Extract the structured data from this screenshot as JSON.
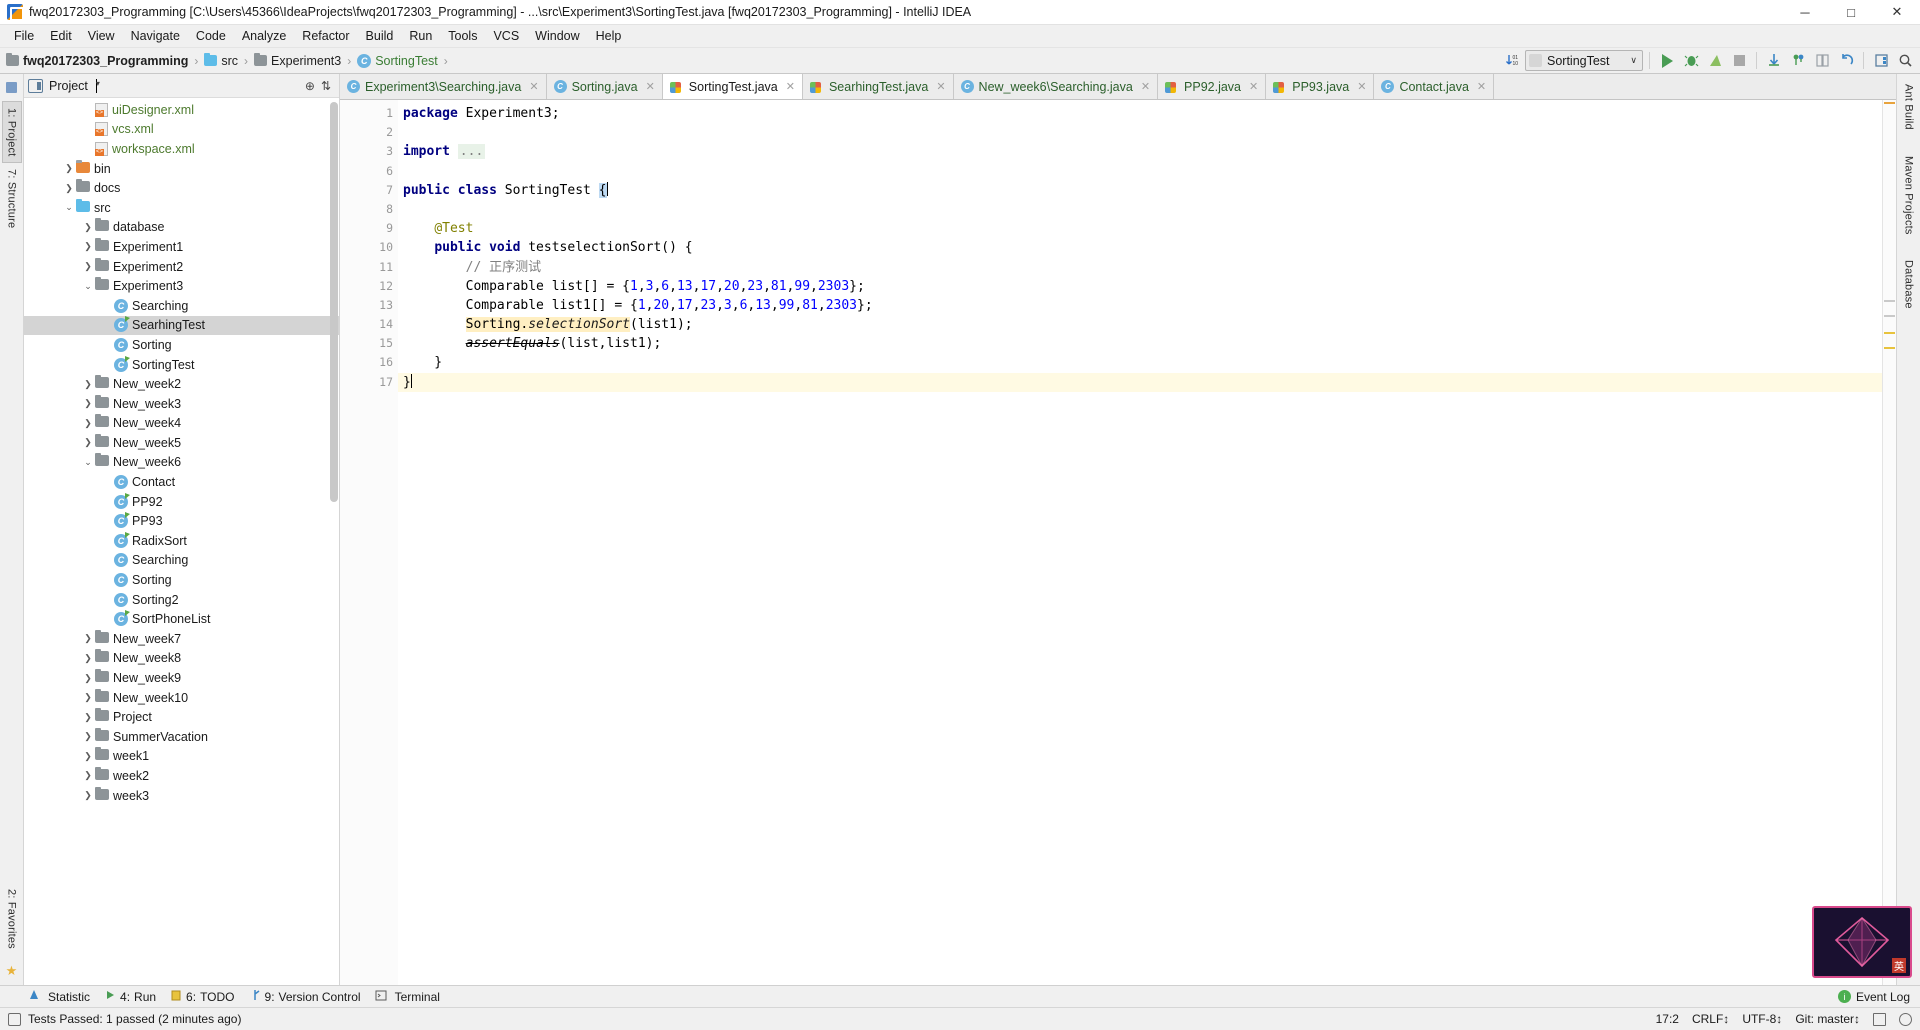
{
  "window": {
    "title": "fwq20172303_Programming [C:\\Users\\45366\\IdeaProjects\\fwq20172303_Programming] - ...\\src\\Experiment3\\SortingTest.java [fwq20172303_Programming] - IntelliJ IDEA",
    "minimize": "─",
    "maximize": "□",
    "close": "✕"
  },
  "menu": [
    {
      "label": "File"
    },
    {
      "label": "Edit"
    },
    {
      "label": "View"
    },
    {
      "label": "Navigate"
    },
    {
      "label": "Code"
    },
    {
      "label": "Analyze"
    },
    {
      "label": "Refactor"
    },
    {
      "label": "Build"
    },
    {
      "label": "Run"
    },
    {
      "label": "Tools"
    },
    {
      "label": "VCS"
    },
    {
      "label": "Window"
    },
    {
      "label": "Help"
    }
  ],
  "breadcrumb": [
    {
      "label": "fwq20172303_Programming",
      "icon": "folder-icon"
    },
    {
      "label": "src",
      "icon": "folder-icon"
    },
    {
      "label": "Experiment3",
      "icon": "folder-icon"
    },
    {
      "label": "SortingTest",
      "icon": "java-class-icon"
    }
  ],
  "toolbar": {
    "sort_icon": "sort-descending-icon",
    "run_config": "SortingTest",
    "run_config_caret": "∨",
    "run_label": "run-button",
    "debug_label": "debug-button",
    "coverage_label": "run-with-coverage-button",
    "stop_label": "stop-button",
    "update_label": "update-project-button",
    "commit_label": "commit-button",
    "compare_label": "compare-button",
    "rollback_label": "rollback-button",
    "layout_label": "layout-button",
    "search_label": "search-everywhere-button"
  },
  "project_panel": {
    "title": "Project",
    "caret": "▾",
    "target_icon": "locate-icon",
    "collapse_icon": "collapse-all-icon",
    "tree": [
      {
        "label": "uiDesigner.xml",
        "indent": 3,
        "arrow": "",
        "icon": "xml-file-icon",
        "selected": false
      },
      {
        "label": "vcs.xml",
        "indent": 3,
        "arrow": "",
        "icon": "xml-file-icon",
        "selected": false
      },
      {
        "label": "workspace.xml",
        "indent": 3,
        "arrow": "",
        "icon": "xml-file-icon",
        "selected": false
      },
      {
        "label": "bin",
        "indent": 2,
        "arrow": "❯",
        "icon": "folder-orange-icon",
        "selected": false
      },
      {
        "label": "docs",
        "indent": 2,
        "arrow": "❯",
        "icon": "folder-icon",
        "selected": false
      },
      {
        "label": "src",
        "indent": 2,
        "arrow": "⌄",
        "icon": "folder-blue-icon",
        "selected": false
      },
      {
        "label": "database",
        "indent": 3,
        "arrow": "❯",
        "icon": "folder-pkg-icon",
        "selected": false
      },
      {
        "label": "Experiment1",
        "indent": 3,
        "arrow": "❯",
        "icon": "folder-pkg-icon",
        "selected": false
      },
      {
        "label": "Experiment2",
        "indent": 3,
        "arrow": "❯",
        "icon": "folder-pkg-icon",
        "selected": false
      },
      {
        "label": "Experiment3",
        "indent": 3,
        "arrow": "⌄",
        "icon": "folder-pkg-icon",
        "selected": false
      },
      {
        "label": "Searching",
        "indent": 4,
        "arrow": "",
        "icon": "java-class-icon",
        "selected": false
      },
      {
        "label": "SearhingTest",
        "indent": 4,
        "arrow": "",
        "icon": "java-test-class-icon",
        "selected": true
      },
      {
        "label": "Sorting",
        "indent": 4,
        "arrow": "",
        "icon": "java-class-icon",
        "selected": false
      },
      {
        "label": "SortingTest",
        "indent": 4,
        "arrow": "",
        "icon": "java-test-class-icon",
        "selected": false
      },
      {
        "label": "New_week2",
        "indent": 3,
        "arrow": "❯",
        "icon": "folder-pkg-icon",
        "selected": false
      },
      {
        "label": "New_week3",
        "indent": 3,
        "arrow": "❯",
        "icon": "folder-pkg-icon",
        "selected": false
      },
      {
        "label": "New_week4",
        "indent": 3,
        "arrow": "❯",
        "icon": "folder-pkg-icon",
        "selected": false
      },
      {
        "label": "New_week5",
        "indent": 3,
        "arrow": "❯",
        "icon": "folder-pkg-icon",
        "selected": false
      },
      {
        "label": "New_week6",
        "indent": 3,
        "arrow": "⌄",
        "icon": "folder-pkg-icon",
        "selected": false
      },
      {
        "label": "Contact",
        "indent": 4,
        "arrow": "",
        "icon": "java-class-icon",
        "selected": false
      },
      {
        "label": "PP92",
        "indent": 4,
        "arrow": "",
        "icon": "java-test-class-icon",
        "selected": false
      },
      {
        "label": "PP93",
        "indent": 4,
        "arrow": "",
        "icon": "java-test-class-icon",
        "selected": false
      },
      {
        "label": "RadixSort",
        "indent": 4,
        "arrow": "",
        "icon": "java-test-class-icon",
        "selected": false
      },
      {
        "label": "Searching",
        "indent": 4,
        "arrow": "",
        "icon": "java-class-icon",
        "selected": false
      },
      {
        "label": "Sorting",
        "indent": 4,
        "arrow": "",
        "icon": "java-class-icon",
        "selected": false
      },
      {
        "label": "Sorting2",
        "indent": 4,
        "arrow": "",
        "icon": "java-class-icon",
        "selected": false
      },
      {
        "label": "SortPhoneList",
        "indent": 4,
        "arrow": "",
        "icon": "java-test-class-icon",
        "selected": false
      },
      {
        "label": "New_week7",
        "indent": 3,
        "arrow": "❯",
        "icon": "folder-pkg-icon",
        "selected": false
      },
      {
        "label": "New_week8",
        "indent": 3,
        "arrow": "❯",
        "icon": "folder-pkg-icon",
        "selected": false
      },
      {
        "label": "New_week9",
        "indent": 3,
        "arrow": "❯",
        "icon": "folder-pkg-icon",
        "selected": false
      },
      {
        "label": "New_week10",
        "indent": 3,
        "arrow": "❯",
        "icon": "folder-pkg-icon",
        "selected": false
      },
      {
        "label": "Project",
        "indent": 3,
        "arrow": "❯",
        "icon": "folder-pkg-icon",
        "selected": false
      },
      {
        "label": "SummerVacation",
        "indent": 3,
        "arrow": "❯",
        "icon": "folder-pkg-icon",
        "selected": false
      },
      {
        "label": "week1",
        "indent": 3,
        "arrow": "❯",
        "icon": "folder-pkg-icon",
        "selected": false
      },
      {
        "label": "week2",
        "indent": 3,
        "arrow": "❯",
        "icon": "folder-pkg-icon",
        "selected": false
      },
      {
        "label": "week3",
        "indent": 3,
        "arrow": "❯",
        "icon": "folder-pkg-icon",
        "selected": false
      }
    ]
  },
  "left_rail": [
    {
      "label": "1: Project",
      "active": true
    },
    {
      "label": "7: Structure",
      "active": false
    },
    {
      "label": "2: Favorites",
      "active": false
    }
  ],
  "right_rail": [
    {
      "label": "Ant Build"
    },
    {
      "label": "Maven Projects"
    },
    {
      "label": "Database"
    }
  ],
  "editor_tabs": [
    {
      "label": "Experiment3\\Searching.java",
      "icon": "java-class-icon",
      "active": false,
      "close": "✕"
    },
    {
      "label": "Sorting.java",
      "icon": "java-class-icon",
      "active": false,
      "close": "✕"
    },
    {
      "label": "SortingTest.java",
      "icon": "java-test-icon",
      "active": true,
      "close": "✕"
    },
    {
      "label": "SearhingTest.java",
      "icon": "java-test-icon",
      "active": false,
      "close": "✕"
    },
    {
      "label": "New_week6\\Searching.java",
      "icon": "java-class-icon",
      "active": false,
      "close": "✕"
    },
    {
      "label": "PP92.java",
      "icon": "java-test-icon",
      "active": false,
      "close": "✕"
    },
    {
      "label": "PP93.java",
      "icon": "java-test-icon",
      "active": false,
      "close": "✕"
    },
    {
      "label": "Contact.java",
      "icon": "java-class-icon",
      "active": false,
      "close": "✕"
    }
  ],
  "code": {
    "line_numbers": [
      "1",
      "2",
      "3",
      "6",
      "7",
      "8",
      "9",
      "10",
      "11",
      "12",
      "13",
      "14",
      "15",
      "16",
      "17"
    ],
    "lines": [
      {
        "no": "1",
        "text": "package Experiment3;"
      },
      {
        "no": "2",
        "text": ""
      },
      {
        "no": "3",
        "text": "import ..."
      },
      {
        "no": "6",
        "text": ""
      },
      {
        "no": "7",
        "text": "public class SortingTest {"
      },
      {
        "no": "8",
        "text": ""
      },
      {
        "no": "9",
        "text": "    @Test"
      },
      {
        "no": "10",
        "text": "    public void testselectionSort() {"
      },
      {
        "no": "11",
        "text": "        // 正序测试"
      },
      {
        "no": "12",
        "text": "        Comparable list[] = {1,3,6,13,17,20,23,81,99,2303};"
      },
      {
        "no": "13",
        "text": "        Comparable list1[] = {1,20,17,23,3,6,13,99,81,2303};"
      },
      {
        "no": "14",
        "text": "        Sorting.selectionSort(list1);"
      },
      {
        "no": "15",
        "text": "        assertEquals(list,list1);"
      },
      {
        "no": "16",
        "text": "    }"
      },
      {
        "no": "17",
        "text": "}"
      }
    ]
  },
  "bottom_tools": [
    {
      "num": "",
      "label": "Statistic",
      "icon": "statistic-icon"
    },
    {
      "num": "4:",
      "label": "Run",
      "icon": "run-icon"
    },
    {
      "num": "6:",
      "label": "TODO",
      "icon": "todo-icon"
    },
    {
      "num": "9:",
      "label": "Version Control",
      "icon": "vcs-icon"
    },
    {
      "num": "",
      "label": "Terminal",
      "icon": "terminal-icon"
    }
  ],
  "event_log": {
    "label": "Event Log",
    "icon": "event-log-icon"
  },
  "statusbar": {
    "message": "Tests Passed: 1 passed (2 minutes ago)",
    "position": "17:2",
    "line_separator": "CRLF↕",
    "encoding": "UTF-8↕",
    "branch": "Git: master↕",
    "lock_icon": "lock-icon",
    "inspection_icon": "inspection-icon",
    "memory_icon": "memory-indicator-icon"
  },
  "widget": {
    "char": "英",
    "name": "ime-indicator"
  },
  "colors": {
    "accent_green": "#499c54",
    "keyword": "#000080",
    "number": "#0000ff",
    "comment": "#808080",
    "annotation": "#808000",
    "caret_line": "#fffae3",
    "selection": "#d4d4d4",
    "tab_active": "#ffffff"
  }
}
